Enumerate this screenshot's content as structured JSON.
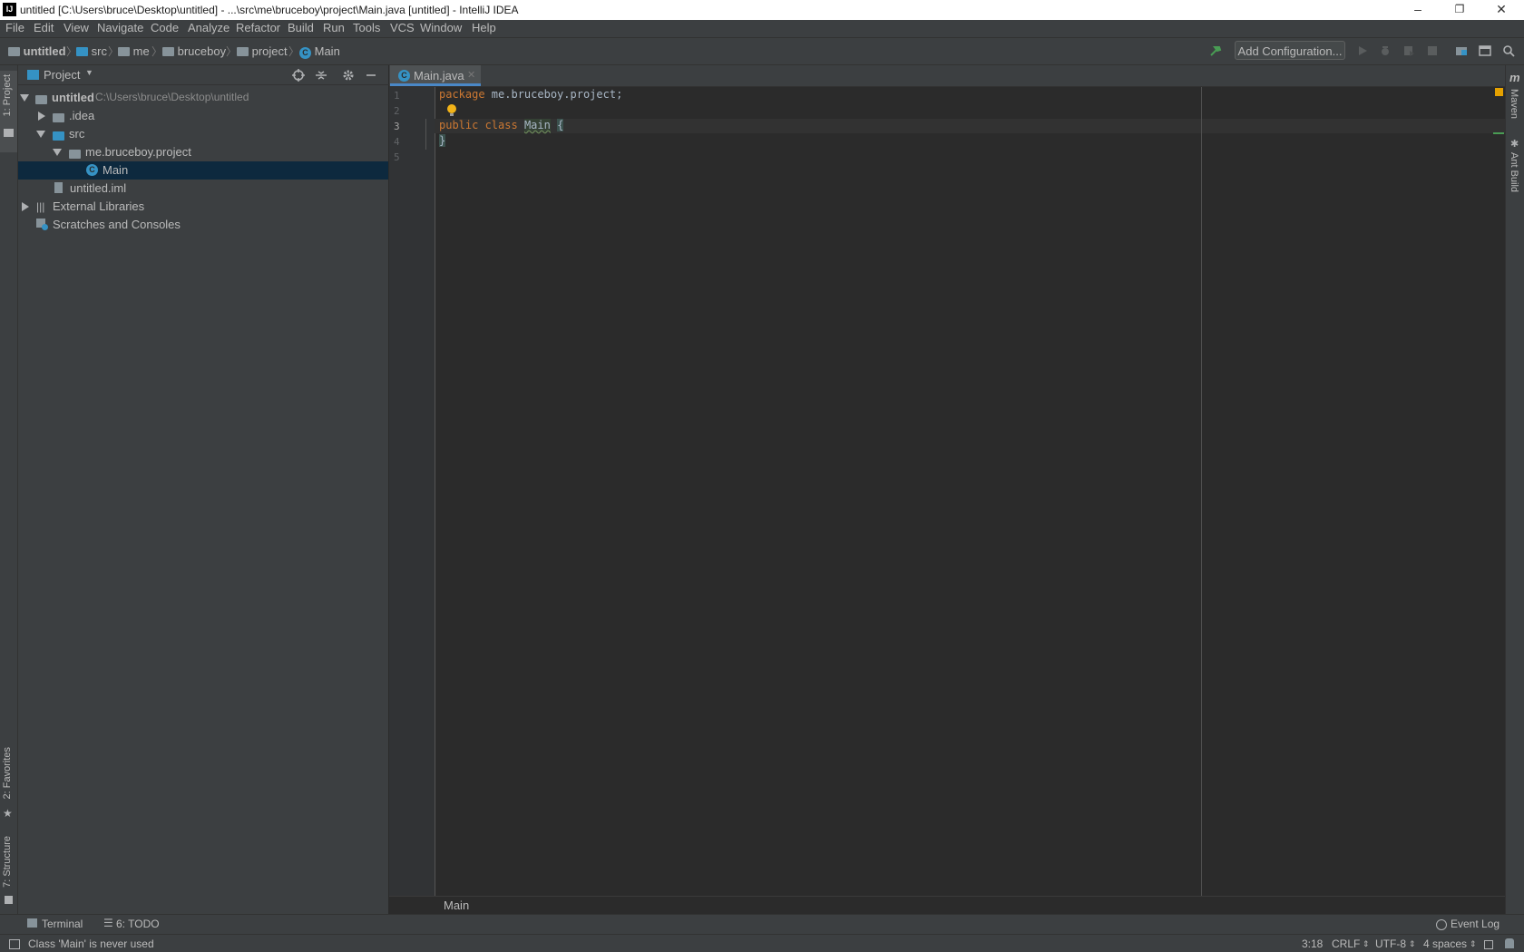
{
  "window": {
    "app_icon": "IJ",
    "title": "untitled [C:\\Users\\bruce\\Desktop\\untitled] - ...\\src\\me\\bruceboy\\project\\Main.java [untitled] - IntelliJ IDEA",
    "minimize_glyph": "–",
    "maximize_glyph": "❐",
    "close_glyph": "✕"
  },
  "menu": [
    "File",
    "Edit",
    "View",
    "Navigate",
    "Code",
    "Analyze",
    "Refactor",
    "Build",
    "Run",
    "Tools",
    "VCS",
    "Window",
    "Help"
  ],
  "breadcrumb": [
    "untitled",
    "src",
    "me",
    "bruceboy",
    "project",
    "Main"
  ],
  "toolbar": {
    "add_configuration": "Add Configuration..."
  },
  "left_strip": {
    "project": "1: Project",
    "favorites": "2: Favorites",
    "structure": "7: Structure"
  },
  "right_strip": {
    "maven": "Maven",
    "ant": "Ant Build",
    "maven_glyph": "m"
  },
  "project_panel": {
    "title": "Project",
    "tree": [
      {
        "label": "untitled",
        "path": "C:\\Users\\bruce\\Desktop\\untitled"
      },
      {
        "label": ".idea"
      },
      {
        "label": "src"
      },
      {
        "label": "me.bruceboy.project"
      },
      {
        "label": "Main"
      },
      {
        "label": "untitled.iml"
      },
      {
        "label": "External Libraries"
      },
      {
        "label": "Scratches and Consoles"
      }
    ]
  },
  "editor": {
    "tab": "Main.java",
    "class_icon_letter": "C",
    "line_numbers": [
      "1",
      "2",
      "3",
      "4",
      "5"
    ],
    "lines": {
      "l1_kw": "package",
      "l1_rest": " me.bruceboy.project;",
      "l3_kw": "public class",
      "l3_name": "Main",
      "l3_brace": "{",
      "l4": "}"
    },
    "breadcrumb": "Main"
  },
  "bottom_tools": {
    "terminal": "Terminal",
    "todo": "6: TODO",
    "event_log": "Event Log"
  },
  "status": {
    "message": "Class 'Main' is never used",
    "position": "3:18",
    "line_sep": "CRLF",
    "encoding": "UTF-8",
    "indent": "4 spaces"
  },
  "colors": {
    "keyword": "#cc7832",
    "selection": "#0d293e",
    "accent": "#3592c4"
  }
}
